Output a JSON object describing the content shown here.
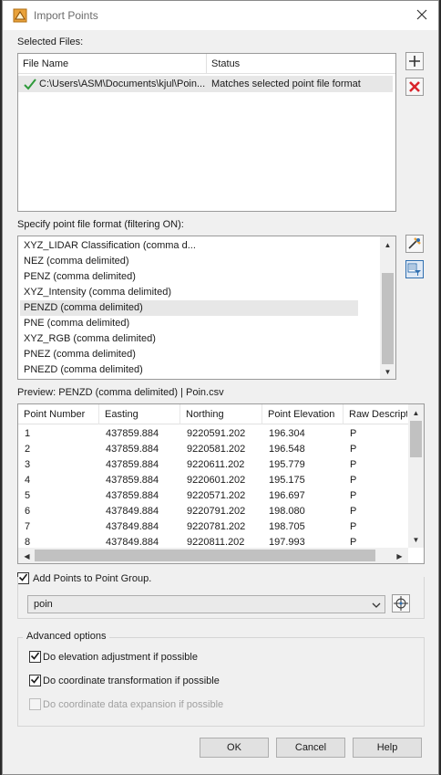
{
  "window": {
    "title": "Import Points"
  },
  "selected_files": {
    "label": "Selected Files:",
    "columns": [
      "File Name",
      "Status"
    ],
    "rows": [
      {
        "file_name": "C:\\Users\\ASM\\Documents\\kjul\\Poin...",
        "status": "Matches selected point file format"
      }
    ]
  },
  "format": {
    "label": "Specify point file format (filtering ON):",
    "items": [
      "XYZ_LIDAR Classification (comma d...",
      "NEZ (comma delimited)",
      "PENZ (comma delimited)",
      "XYZ_Intensity (comma delimited)",
      "PENZD (comma delimited)",
      "PNE (comma delimited)",
      "XYZ_RGB (comma delimited)",
      "PNEZ (comma delimited)",
      "PNEZD (comma delimited)"
    ],
    "selected": "PENZD (comma delimited)"
  },
  "preview": {
    "label": "Preview: PENZD (comma delimited) | Poin.csv",
    "columns": [
      "Point Number",
      "Easting",
      "Northing",
      "Point Elevation",
      "Raw Descripti"
    ],
    "rows": [
      [
        "1",
        "437859.884",
        "9220591.202",
        "196.304",
        "P"
      ],
      [
        "2",
        "437859.884",
        "9220581.202",
        "196.548",
        "P"
      ],
      [
        "3",
        "437859.884",
        "9220611.202",
        "195.779",
        "P"
      ],
      [
        "4",
        "437859.884",
        "9220601.202",
        "195.175",
        "P"
      ],
      [
        "5",
        "437859.884",
        "9220571.202",
        "196.697",
        "P"
      ],
      [
        "6",
        "437849.884",
        "9220791.202",
        "198.080",
        "P"
      ],
      [
        "7",
        "437849.884",
        "9220781.202",
        "198.705",
        "P"
      ],
      [
        "8",
        "437849.884",
        "9220811.202",
        "197.993",
        "P"
      ]
    ]
  },
  "point_group": {
    "checkbox_label": "Add Points to Point Group.",
    "checked": true,
    "value": "poin"
  },
  "advanced": {
    "label": "Advanced options",
    "options": [
      {
        "label": "Do elevation adjustment if possible",
        "checked": true,
        "enabled": true
      },
      {
        "label": "Do coordinate transformation if possible",
        "checked": true,
        "enabled": true
      },
      {
        "label": "Do coordinate data expansion if possible",
        "checked": false,
        "enabled": false
      }
    ]
  },
  "buttons": {
    "ok": "OK",
    "cancel": "Cancel",
    "help": "Help"
  },
  "colors": {
    "dialog_bg": "#f0f0f0",
    "selection_bg": "#e7e7e7",
    "remove_red": "#d9242b",
    "check_green": "#2e9a3a",
    "icon_blue": "#2f6fb0"
  }
}
